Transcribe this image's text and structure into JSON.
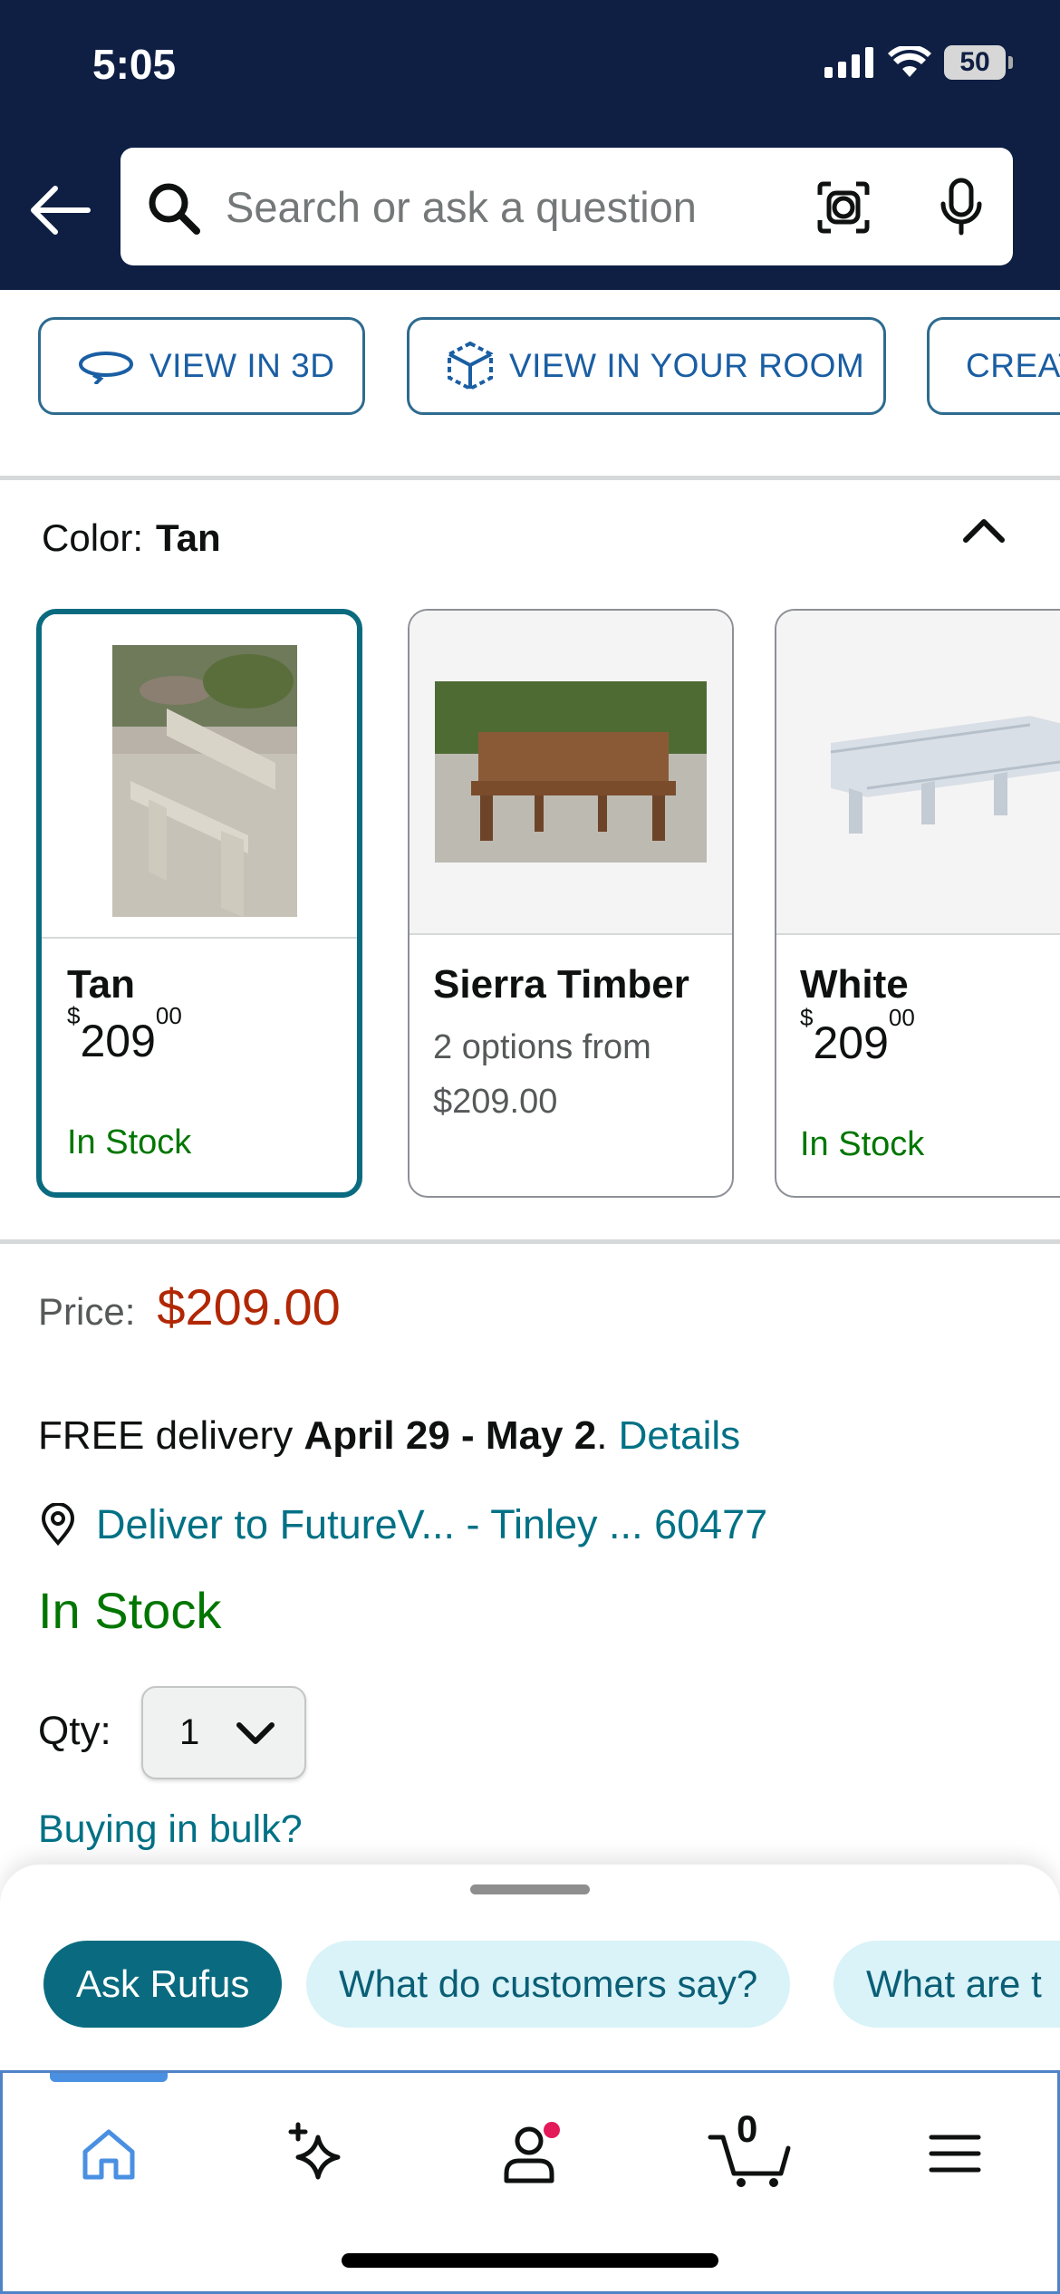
{
  "status_bar": {
    "time": "5:05",
    "battery": "50"
  },
  "search": {
    "placeholder": "Search or ask a question"
  },
  "actions": [
    {
      "label": "VIEW IN 3D"
    },
    {
      "label": "VIEW IN YOUR ROOM"
    },
    {
      "label": "CREAT"
    }
  ],
  "color": {
    "label": "Color:",
    "selected": "Tan",
    "options": [
      {
        "name": "Tan",
        "price_whole": "209",
        "price_fraction": "00",
        "currency": "$",
        "stock": "In Stock",
        "selected": true
      },
      {
        "name": "Sierra Timber",
        "sub_line1": "2 options from",
        "sub_line2": "$209.00",
        "selected": false
      },
      {
        "name": "White",
        "price_whole": "209",
        "price_fraction": "00",
        "currency": "$",
        "stock": "In Stock",
        "selected": false
      }
    ]
  },
  "price": {
    "label": "Price:",
    "value": "$209.00"
  },
  "delivery": {
    "prefix": "FREE delivery ",
    "dates": "April 29 - May 2",
    "separator": ". ",
    "details_link": "Details",
    "deliver_to": "Deliver to FutureV... - Tinley ... 60477"
  },
  "stock_status": "In Stock",
  "quantity": {
    "label": "Qty:",
    "value": "1"
  },
  "bulk_link": "Buying in bulk?",
  "rufus": {
    "chips": [
      {
        "label": "Ask Rufus",
        "primary": true
      },
      {
        "label": "What do customers say?",
        "primary": false
      },
      {
        "label": "What are t",
        "primary": false
      }
    ]
  },
  "bottom_nav": {
    "items": [
      "home-icon",
      "sparkle-icon",
      "account-icon",
      "cart-icon",
      "menu-icon"
    ],
    "cart_count": "0"
  },
  "colors": {
    "header_bg": "#0f1f44",
    "link": "#007185",
    "price_red": "#b12704",
    "stock_green": "#007600",
    "rufus_teal": "#0a6b80"
  }
}
